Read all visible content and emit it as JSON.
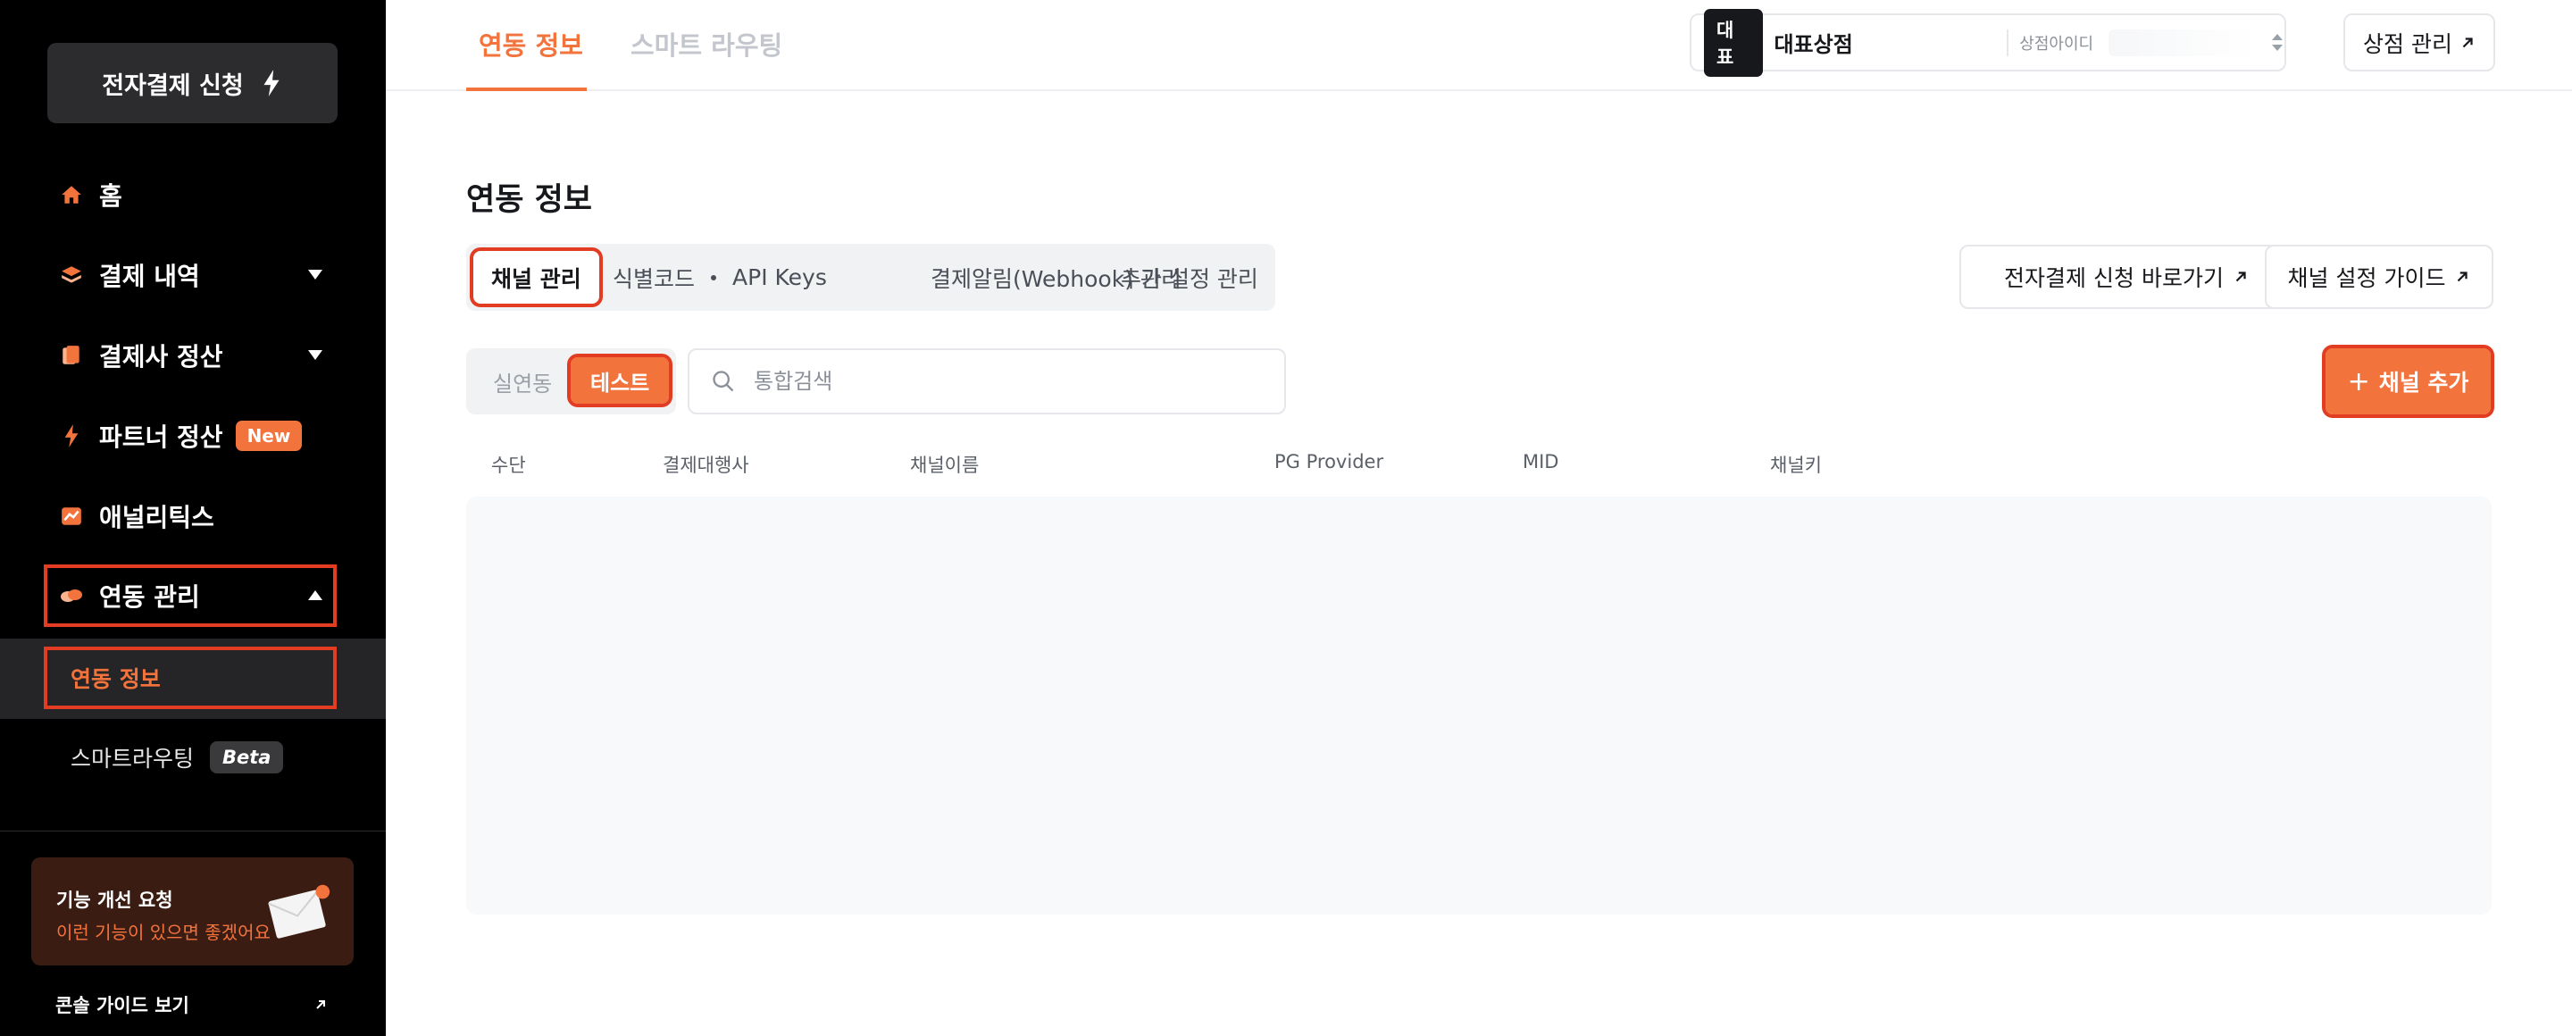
{
  "sidebar": {
    "apply_label": "전자결제 신청",
    "nav": [
      {
        "label": "홈",
        "icon": "home-icon"
      },
      {
        "label": "결제 내역",
        "icon": "layers-icon"
      },
      {
        "label": "결제사 정산",
        "icon": "document-icon"
      },
      {
        "label": "파트너 정산",
        "icon": "lightning-icon",
        "badge": "New"
      },
      {
        "label": "애널리틱스",
        "icon": "analytics-icon"
      },
      {
        "label": "연동 관리",
        "icon": "link-icon"
      }
    ],
    "sub_items": [
      {
        "label": "연동 정보"
      },
      {
        "label": "스마트라우팅",
        "badge": "Beta"
      }
    ],
    "feedback": {
      "title": "기능 개선 요청",
      "subtitle": "이런 기능이 있으면 좋겠어요"
    },
    "guide_label": "콘솔 가이드 보기"
  },
  "topbar": {
    "tabs": [
      {
        "label": "연동 정보"
      },
      {
        "label": "스마트 라우팅"
      }
    ],
    "store": {
      "tag": "대표",
      "name": "대표상점",
      "id_label": "상점아이디",
      "id_value": ""
    },
    "manage_label": "상점 관리"
  },
  "main": {
    "title": "연동 정보",
    "sub_tabs": [
      {
        "label": "채널 관리"
      },
      {
        "label": "식별코드"
      },
      {
        "label": "API Keys"
      },
      {
        "label": "결제알림(Webhook) 관리"
      },
      {
        "label": "추가 설정 관리"
      }
    ],
    "apply_shortcut_label": "전자결제 신청 바로가기",
    "channel_guide_label": "채널 설정 가이드",
    "env": {
      "live": "실연동",
      "test": "테스트"
    },
    "search": {
      "placeholder": "통합검색",
      "value": ""
    },
    "add_channel_label": "채널 추가",
    "columns": [
      "수단",
      "결제대행사",
      "채널이름",
      "PG Provider",
      "MID",
      "채널키"
    ]
  },
  "colors": {
    "accent": "#f3733d",
    "sidebar_bg": "#000000",
    "highlight": "#e23d22"
  }
}
